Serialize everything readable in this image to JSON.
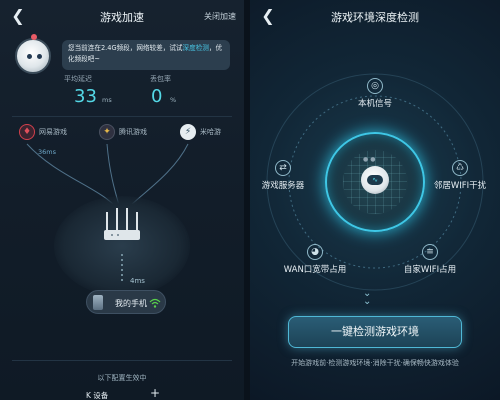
{
  "left": {
    "header": {
      "title": "游戏加速",
      "close_label": "关闭加速"
    },
    "tip": {
      "text_before": "您当前连在2.4G频段，网络较差，试试",
      "highlight": "深度检测",
      "text_after": "，优化频段吧~"
    },
    "stats": {
      "latency_label": "平均延迟",
      "latency_value": "33",
      "latency_unit": "ms",
      "loss_label": "丢包率",
      "loss_value": "0",
      "loss_unit": "%"
    },
    "games": [
      {
        "label": "网易游戏",
        "icon": "netease-icon",
        "color": "#d2404c"
      },
      {
        "label": "腾讯游戏",
        "icon": "tencent-icon",
        "color": "#e6b84a"
      },
      {
        "label": "米哈游",
        "icon": "mihoyo-icon",
        "color": "#dfe6ea"
      }
    ],
    "game_latency": "36ms",
    "router_latency": "4ms",
    "device_label": "我的手机",
    "config_label": "以下配置生效中",
    "device_row_label": "K 设备"
  },
  "right": {
    "header": {
      "title": "游戏环境深度检测"
    },
    "nodes": {
      "signal": "本机信号",
      "server": "游戏服务器",
      "interference": "邻居WIFI干扰",
      "wan": "WAN口宽带占用",
      "home_wifi": "自家WIFI占用"
    },
    "cta_label": "一键检测游戏环境",
    "cta_sub": "开始游戏前·检测游戏环境·消除干扰·确保畅快游戏体验"
  },
  "colors": {
    "accent": "#54d8e6",
    "highlight": "#49c7e6",
    "background": "#0b1622"
  }
}
